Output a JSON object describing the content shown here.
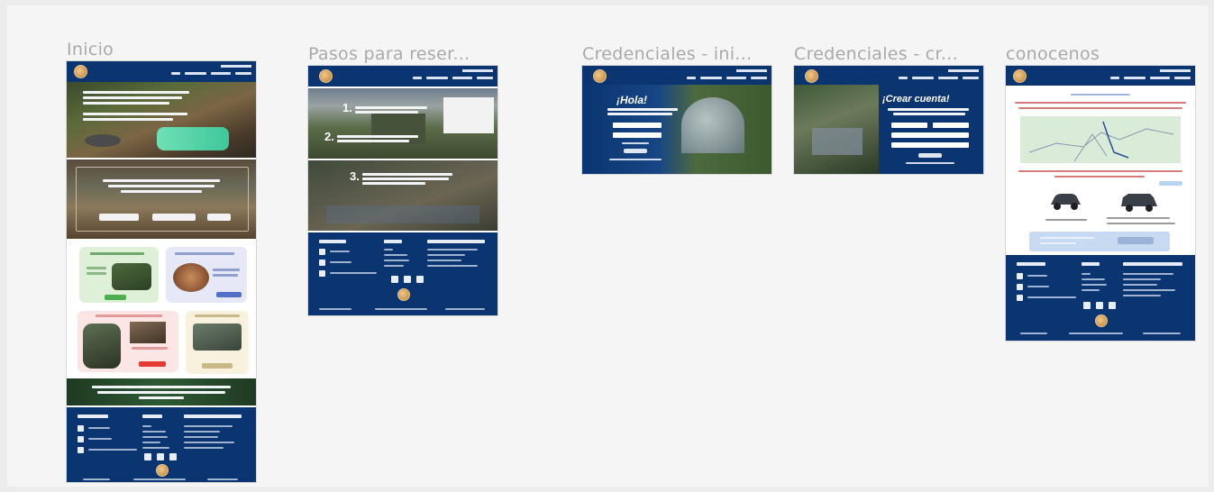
{
  "frames": {
    "inicio": {
      "label": "Inicio"
    },
    "pasos": {
      "label": "Pasos para reser..."
    },
    "cred_ini": {
      "label": "Credenciales - ini..."
    },
    "cred_cr": {
      "label": "Credenciales - cr..."
    },
    "conocenos": {
      "label": "conocenos"
    }
  },
  "login": {
    "greeting": "¡Hola!"
  },
  "signup": {
    "greeting": "¡Crear cuenta!"
  },
  "steps": {
    "one": "1.",
    "two": "2.",
    "three": "3."
  },
  "colors": {
    "navy": "#0a3570",
    "green": "#4caf50",
    "red": "#e53935",
    "gold": "#c9b98a"
  },
  "icons": [
    "logo-icon",
    "phone-icon",
    "mail-icon",
    "location-icon",
    "facebook-icon",
    "instagram-icon",
    "tiktok-icon",
    "car-icon",
    "suv-icon"
  ]
}
